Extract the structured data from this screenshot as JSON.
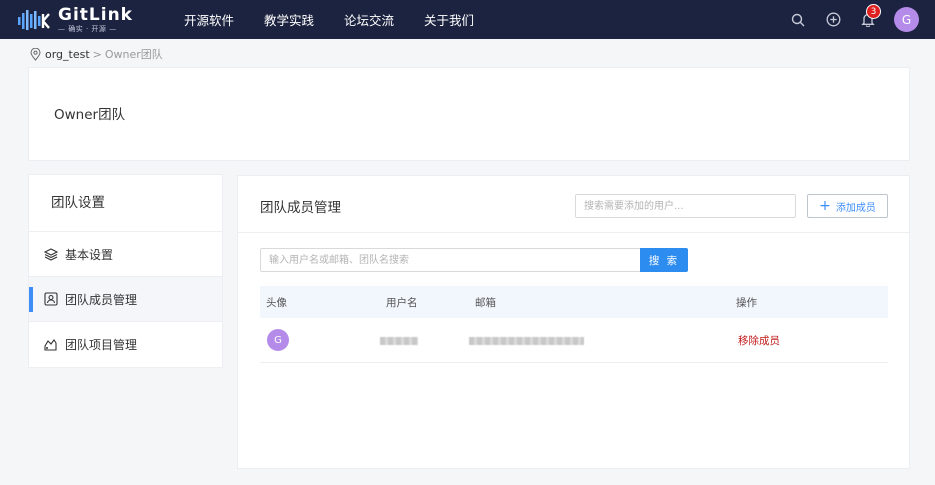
{
  "nav": {
    "logo_name": "GitLink",
    "logo_slogan": "— 确实 · 开源 —",
    "items": [
      "开源软件",
      "教学实践",
      "论坛交流",
      "关于我们"
    ],
    "notification_count": "3",
    "avatar_letter": "G"
  },
  "breadcrumb": {
    "org": "org_test",
    "separator": ">",
    "current": "Owner团队"
  },
  "team": {
    "title": "Owner团队"
  },
  "side": {
    "heading": "团队设置",
    "items": [
      {
        "label": "基本设置",
        "icon": "layers-icon"
      },
      {
        "label": "团队成员管理",
        "icon": "member-card-icon",
        "active": true
      },
      {
        "label": "团队项目管理",
        "icon": "project-icon"
      }
    ]
  },
  "main": {
    "title": "团队成员管理",
    "add_placeholder": "搜索需要添加的用户...",
    "add_button": "添加成员",
    "search_placeholder": "输入用户名或邮箱、团队名搜索",
    "search_button": "搜 索",
    "columns": [
      "头像",
      "用户名",
      "邮箱",
      "操作"
    ],
    "rows": [
      {
        "avatar": "G",
        "username": "",
        "email": "",
        "action": "移除成员"
      }
    ]
  },
  "colors": {
    "nav_bg": "#1c2340",
    "accent": "#2d8cf0",
    "danger": "#c11a1a",
    "avatar": "#b58be9"
  }
}
